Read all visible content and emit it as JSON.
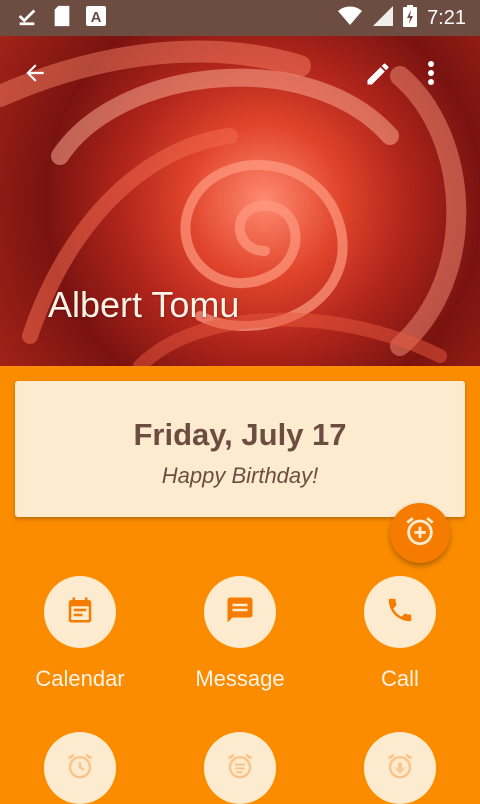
{
  "status_bar": {
    "time": "7:21",
    "icons": [
      "download-done-icon",
      "sd-card-icon",
      "text-font-icon",
      "wifi-icon",
      "signal-icon",
      "battery-icon"
    ]
  },
  "header": {
    "contact_name": "Albert Tomu",
    "icons": [
      "back-arrow-icon",
      "edit-pencil-icon",
      "more-vert-icon"
    ]
  },
  "event_card": {
    "date": "Friday, July 17",
    "message": "Happy Birthday!"
  },
  "fab": {
    "icon": "alarm-add-icon"
  },
  "actions": [
    {
      "label": "Calendar",
      "icon": "calendar-icon"
    },
    {
      "label": "Message",
      "icon": "message-icon"
    },
    {
      "label": "Call",
      "icon": "phone-icon"
    }
  ],
  "reminders": [
    {
      "icon": "alarm-icon"
    },
    {
      "icon": "alarm-text-icon"
    },
    {
      "icon": "alarm-mic-icon"
    }
  ],
  "colors": {
    "status_bar": "#6d4c41",
    "background": "#fb8c00",
    "card": "#fdebd0",
    "accent_dark": "#f57c00",
    "text_brown": "#6d4c41"
  }
}
